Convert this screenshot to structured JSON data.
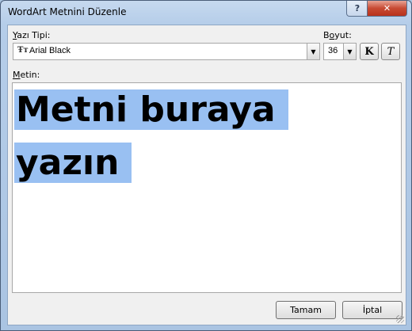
{
  "window": {
    "title": "WordArt Metnini Düzenle",
    "help_label": "?",
    "close_label": "✕"
  },
  "font": {
    "label_key": "Y",
    "label_rest": "azı Tipi:",
    "value": "Arial Black",
    "icon": "truetype-font-icon",
    "icon_glyph": "Ŧт"
  },
  "size": {
    "label_prefix": "B",
    "label_key": "o",
    "label_rest": "yut:",
    "value": "36"
  },
  "format": {
    "bold_label": "K",
    "italic_label": "T"
  },
  "text": {
    "label_key": "M",
    "label_rest": "etin:",
    "line1": "Metni buraya",
    "line2": "yazın"
  },
  "buttons": {
    "ok": "Tamam",
    "cancel": "İptal"
  },
  "colors": {
    "selection": "#99c0f2",
    "close_button": "#c74a33"
  }
}
